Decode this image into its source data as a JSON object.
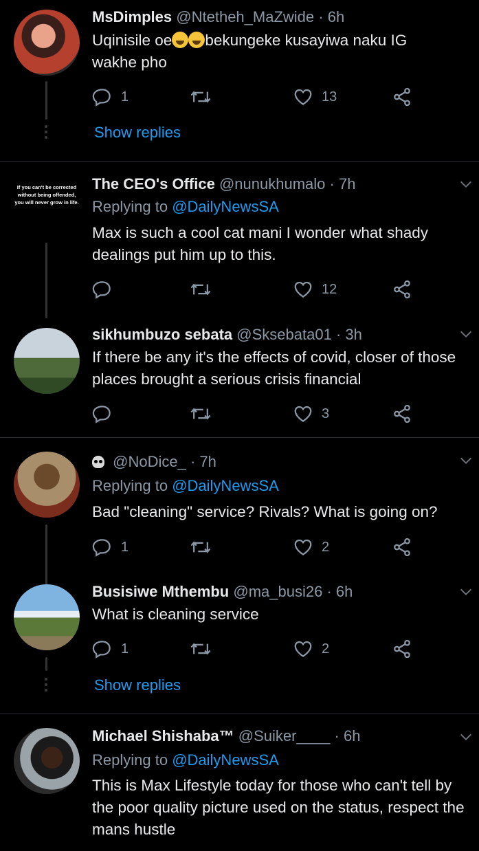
{
  "tweets": [
    {
      "name": "MsDimples",
      "handle": "@Ntetheh_MaZwide",
      "time": "6h",
      "text_a": "Uqinisile oe",
      "text_b": "bekungeke kusayiwa naku IG",
      "text_c": "wakhe pho",
      "replies": "1",
      "retweets": "",
      "likes": "13",
      "show_replies": "Show replies"
    },
    {
      "name": "The CEO's Office",
      "handle": "@nunukhumalo",
      "time": "7h",
      "replying_prefix": "Replying to",
      "replying_to": "@DailyNewsSA",
      "text": "Max is such a cool cat mani I wonder what shady dealings put him up to this.",
      "replies": "",
      "retweets": "",
      "likes": "12",
      "avatar_quote": "If you can't be corrected without being offended, you will never grow in life."
    },
    {
      "name": "sikhumbuzo sebata",
      "handle": "@Sksebata01",
      "time": "3h",
      "text": "If there be any it's the effects of covid, closer of those places brought a serious crisis financial",
      "replies": "",
      "retweets": "",
      "likes": "3"
    },
    {
      "name": "",
      "handle": "@NoDice_",
      "time": "7h",
      "replying_prefix": "Replying to",
      "replying_to": "@DailyNewsSA",
      "text": "Bad \"cleaning\" service? Rivals? What is going on?",
      "replies": "1",
      "retweets": "",
      "likes": "2"
    },
    {
      "name": "Busisiwe Mthembu",
      "handle": "@ma_busi26",
      "time": "6h",
      "text": "What is cleaning service",
      "replies": "1",
      "retweets": "",
      "likes": "2",
      "show_replies": "Show replies"
    },
    {
      "name": "Michael Shishaba™",
      "handle": "@Suiker____",
      "time": "6h",
      "replying_prefix": "Replying to",
      "replying_to": "@DailyNewsSA",
      "text": "This is Max Lifestyle today for those who can't tell by the poor quality picture used on the status, respect the mans hustle"
    }
  ],
  "separator": "·",
  "icons": {
    "reply": "reply-icon",
    "retweet": "retweet-icon",
    "like": "heart-icon",
    "share": "share-icon",
    "more": "chevron-down-icon"
  },
  "colors": {
    "background": "#000000",
    "link": "#1d9bf0",
    "muted": "#8b98a5"
  }
}
